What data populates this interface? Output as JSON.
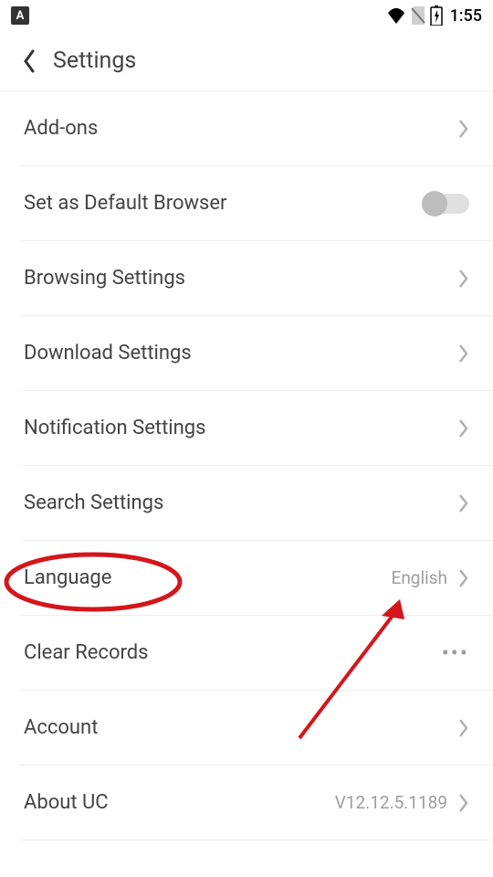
{
  "status": {
    "time": "1:55",
    "app_badge": "A"
  },
  "header": {
    "title": "Settings"
  },
  "items": {
    "addons": "Add-ons",
    "default_browser": "Set as Default Browser",
    "browsing": "Browsing Settings",
    "download": "Download Settings",
    "notification": "Notification Settings",
    "search": "Search Settings",
    "language": "Language",
    "language_value": "English",
    "clear_records": "Clear Records",
    "account": "Account",
    "about": "About UC",
    "about_value": "V12.12.5.1189"
  }
}
